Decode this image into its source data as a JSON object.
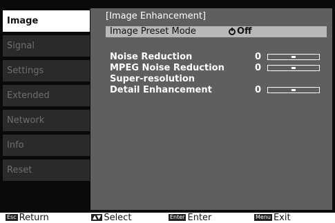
{
  "sidebar": {
    "items": [
      {
        "label": "Image"
      },
      {
        "label": "Signal"
      },
      {
        "label": "Settings"
      },
      {
        "label": "Extended"
      },
      {
        "label": "Network"
      },
      {
        "label": "Info"
      },
      {
        "label": "Reset"
      }
    ]
  },
  "panel": {
    "title": "[Image Enhancement]",
    "preset": {
      "label": "Image Preset Mode",
      "value": "Off",
      "icon": "power-icon"
    },
    "settings": [
      {
        "label": "Noise Reduction",
        "value": "0",
        "level": 0.5
      },
      {
        "label": "MPEG Noise Reduction",
        "value": "0",
        "level": 0.5
      },
      {
        "label": "Super-resolution"
      },
      {
        "label": "Detail Enhancement",
        "value": "0",
        "level": 0.5
      }
    ]
  },
  "footer": {
    "return_key": "Esc",
    "return_label": "Return",
    "select_key": "▲▼",
    "select_label": "Select",
    "enter_key": "Enter",
    "enter_label": "Enter",
    "exit_key": "Menu",
    "exit_label": "Exit"
  },
  "colors": {
    "screen_bg": "#0a0a0a",
    "tab_bg": "#2a2a2a",
    "tab_text": "#6e6e6e",
    "active_tab_bg": "#ffffff",
    "panel_bg": "#5f5f60",
    "highlight_bg": "#b8b8b8"
  }
}
